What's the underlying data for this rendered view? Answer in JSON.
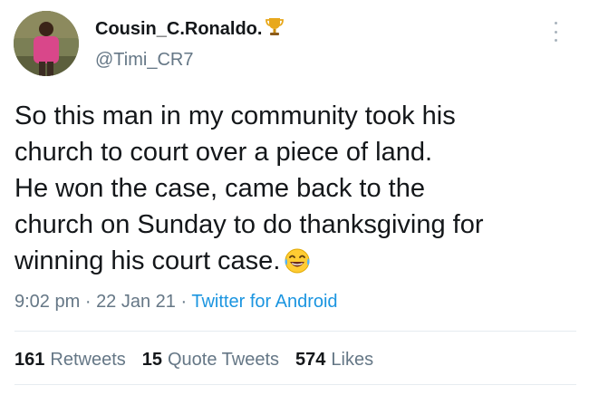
{
  "user": {
    "display_name": "Cousin_C.Ronaldo.",
    "badge_icon": "trophy-icon",
    "handle": "@Timi_CR7"
  },
  "tweet": {
    "lines": [
      "So this man in my community took his",
      "church to court over a piece of land.",
      "He won the case, came back to the",
      "church on Sunday to do thanksgiving for",
      "winning his court case."
    ],
    "emoji_icon": "laughing-tears-emoji-icon"
  },
  "meta": {
    "time": "9:02 pm",
    "separator": "·",
    "date": "22 Jan 21",
    "source": "Twitter for Android"
  },
  "stats": {
    "retweets_count": "161",
    "retweets_label": "Retweets",
    "quotes_count": "15",
    "quotes_label": "Quote Tweets",
    "likes_count": "574",
    "likes_label": "Likes"
  },
  "colors": {
    "text": "#14171a",
    "secondary": "#657786",
    "link": "#1b95e0",
    "divider": "#e6ecf0"
  }
}
